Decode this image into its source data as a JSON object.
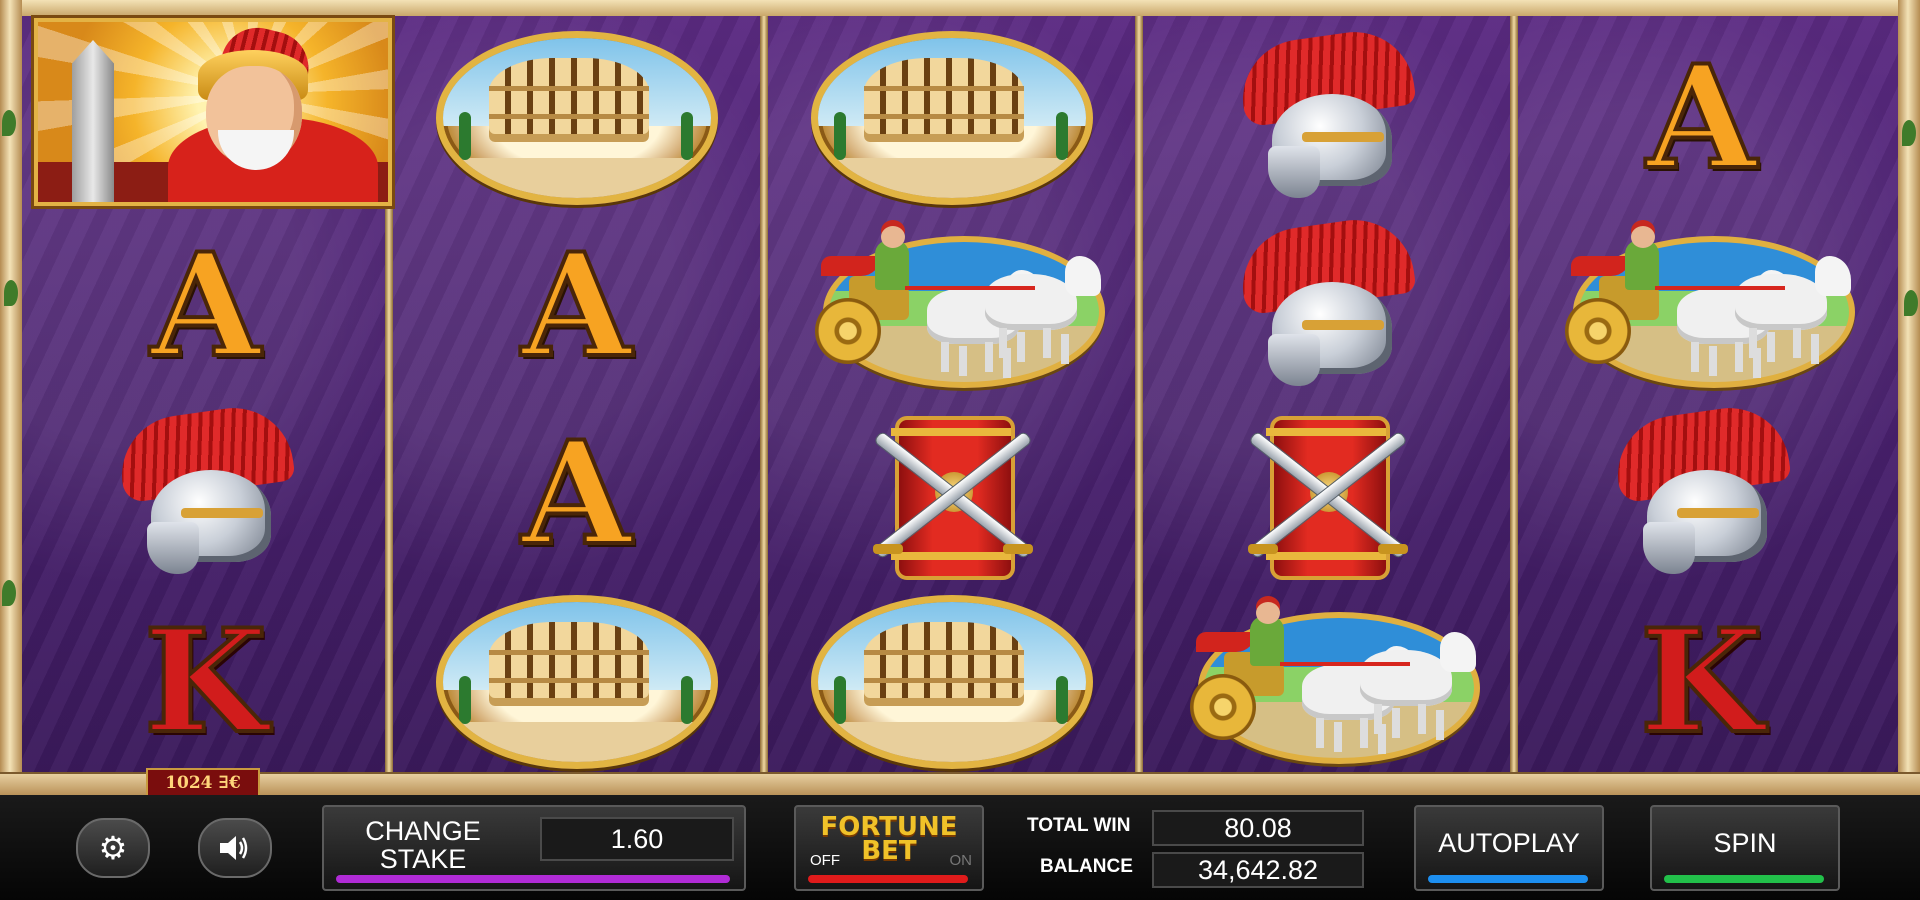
{
  "game": {
    "ways_badge": "1024 ∃€",
    "reels": [
      {
        "rows": [
          "wild-centurion",
          "A",
          "helmet",
          "K"
        ]
      },
      {
        "rows": [
          "colosseum",
          "A",
          "A",
          "colosseum"
        ]
      },
      {
        "rows": [
          "colosseum",
          "chariot",
          "shield",
          "colosseum"
        ]
      },
      {
        "rows": [
          "helmet",
          "helmet",
          "shield",
          "chariot"
        ]
      },
      {
        "rows": [
          "A",
          "chariot",
          "helmet",
          "K"
        ]
      }
    ],
    "letters": {
      "ace": "A",
      "king": "K"
    }
  },
  "controls": {
    "settings_icon": "gear-icon",
    "sound_icon": "speaker-icon",
    "stake_label_line1": "CHANGE",
    "stake_label_line2": "STAKE",
    "stake_value": "1.60",
    "fortune_line1": "FORTUNE",
    "fortune_line2": "BET",
    "fortune_off": "OFF",
    "fortune_on": "ON",
    "total_win_label": "TOTAL WIN",
    "total_win_value": "80.08",
    "balance_label": "BALANCE",
    "balance_value": "34,642.82",
    "autoplay_label": "AUTOPLAY",
    "spin_label": "SPIN"
  },
  "colors": {
    "stake_bar": "#b02bd6",
    "fortune_bar": "#e01b1b",
    "autoplay_bar": "#1d8ff0",
    "spin_bar": "#22c04a"
  }
}
